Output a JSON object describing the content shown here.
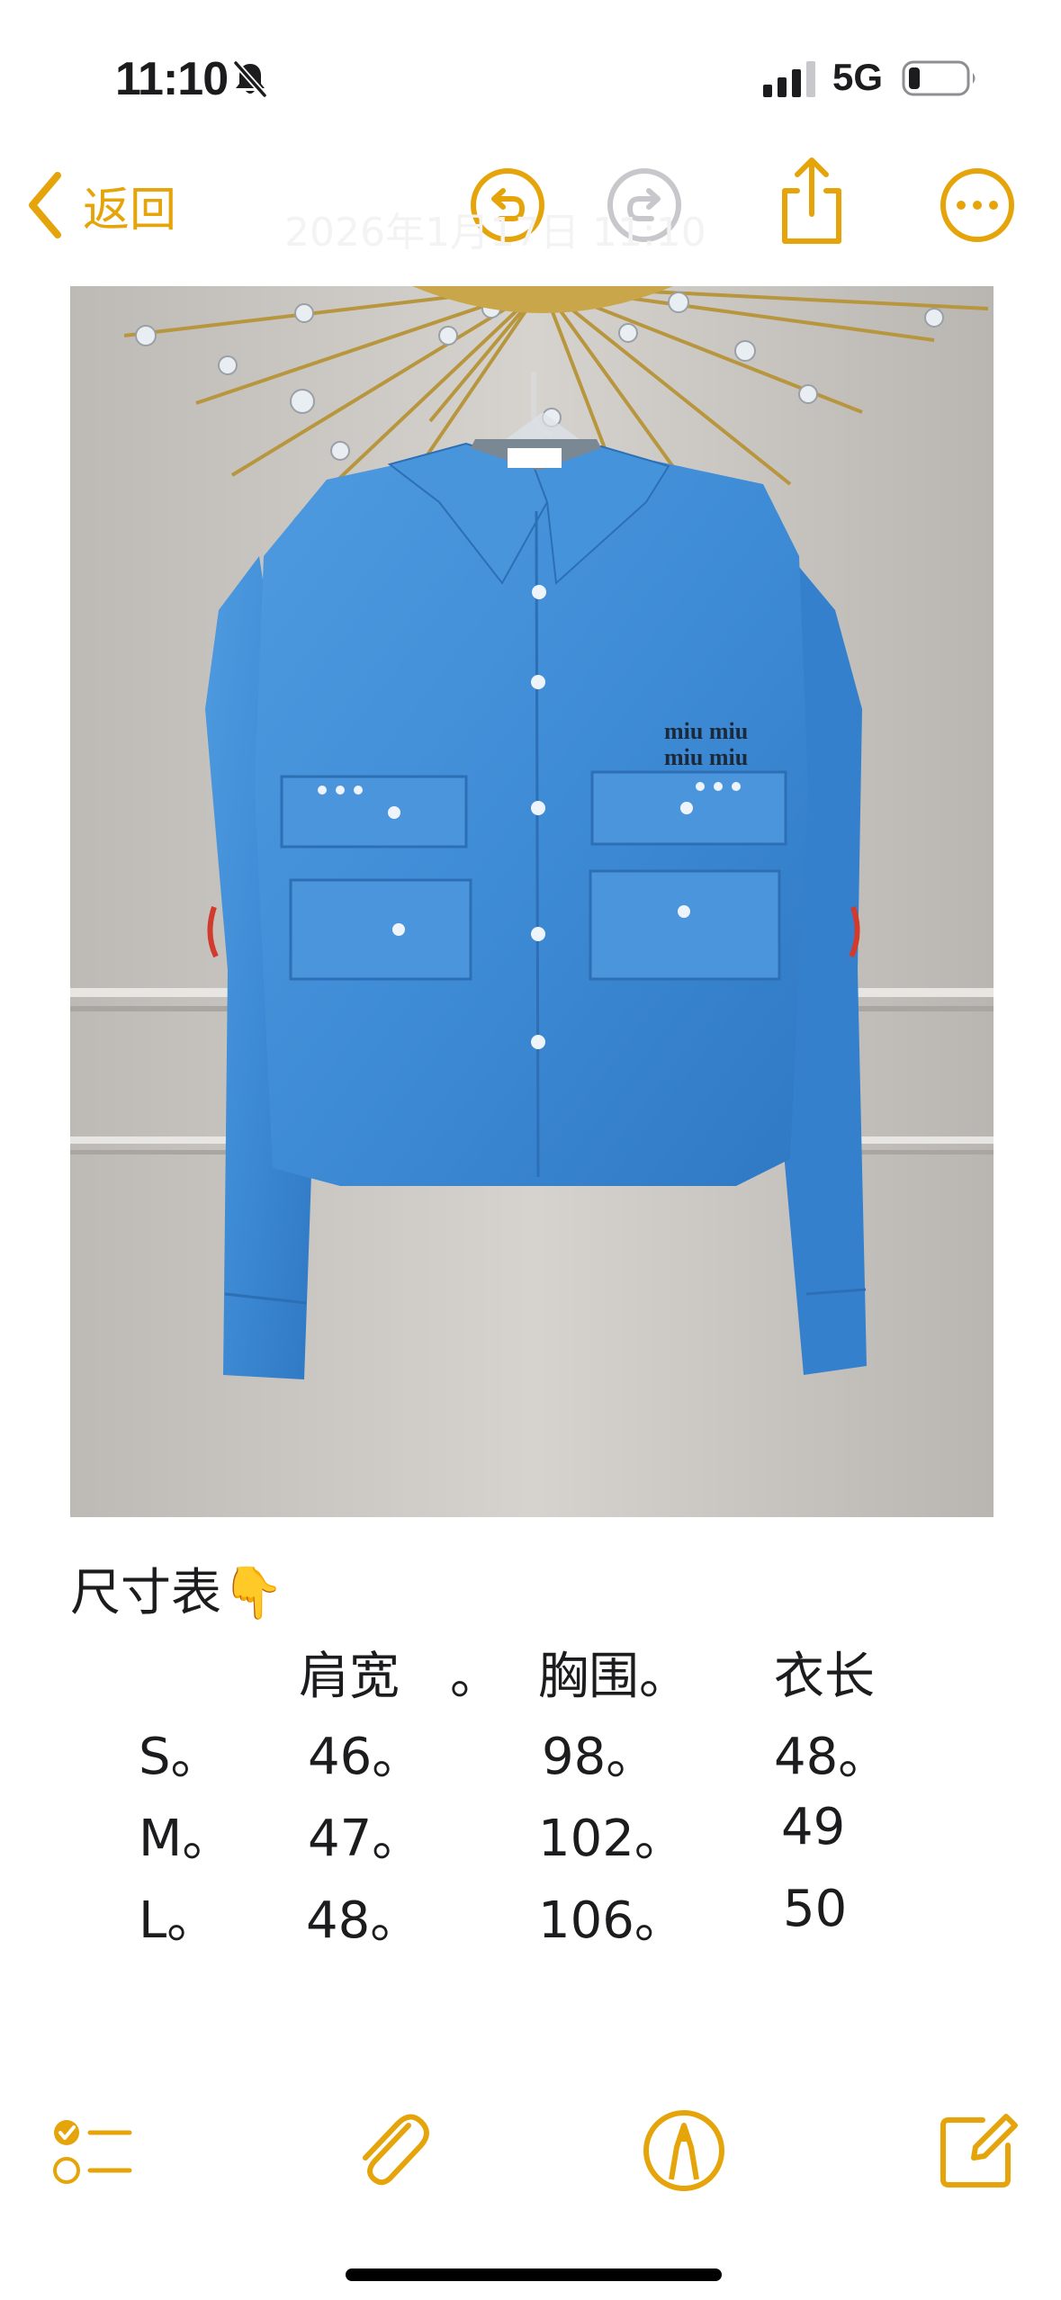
{
  "status_bar": {
    "time": "11:10",
    "network": "5G",
    "icons": [
      "bell-off-icon",
      "cellular-signal-icon",
      "battery-icon"
    ],
    "battery_level": 0.2
  },
  "nav": {
    "back_label": "返回",
    "note_date": "2026年1月17日 11:10",
    "icons": [
      "chevron-left-icon",
      "undo-icon",
      "redo-icon",
      "share-icon",
      "more-icon"
    ]
  },
  "colors": {
    "accent": "#e5a50a",
    "disabled": "#c7c7cc",
    "text": "#1c1c1e"
  },
  "note": {
    "title": "尺寸表",
    "title_emoji": "👇",
    "table": {
      "headers": [
        "",
        "肩宽　。",
        "胸围。",
        "衣长"
      ],
      "rows": [
        [
          "S。",
          "46。",
          "98。",
          "48。"
        ],
        [
          "M。",
          "47。",
          "102。",
          "49"
        ],
        [
          "L。",
          "48。",
          "106。",
          "50"
        ]
      ]
    }
  },
  "toolbar": {
    "icons": [
      "checklist-icon",
      "paperclip-icon",
      "markup-pen-icon",
      "compose-icon"
    ]
  }
}
